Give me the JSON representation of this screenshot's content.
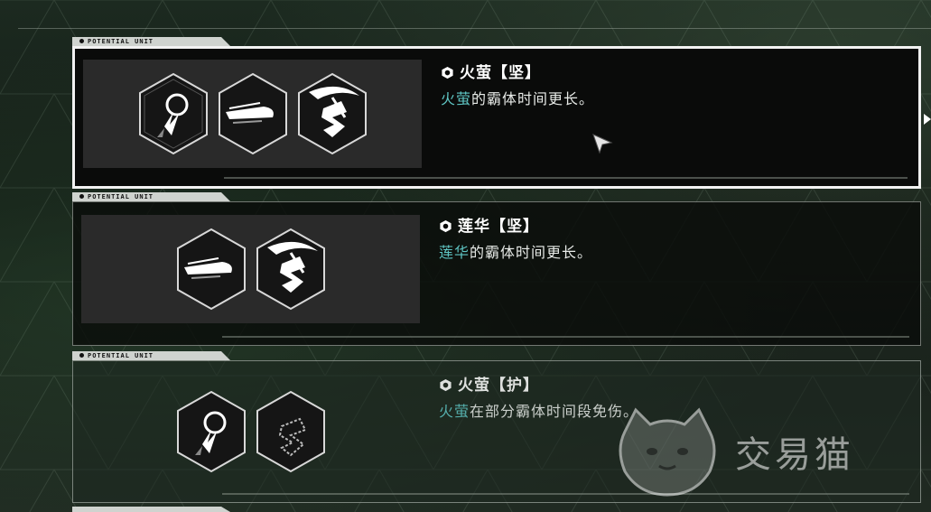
{
  "cards": [
    {
      "tag": "POTENTIAL UNIT",
      "title": "火萤【坚】",
      "desc_keyword": "火萤",
      "desc_rest": "的霸体时间更长。",
      "icons": [
        "flame-orb-icon",
        "dash-slash-icon",
        "scythe-strike-icon"
      ],
      "selected": true
    },
    {
      "tag": "POTENTIAL UNIT",
      "title": "莲华【坚】",
      "desc_keyword": "莲华",
      "desc_rest": "的霸体时间更长。",
      "icons": [
        "dash-slash-icon",
        "scythe-strike-icon"
      ],
      "selected": false
    },
    {
      "tag": "POTENTIAL UNIT",
      "title": "火萤【护】",
      "desc_keyword": "火萤",
      "desc_rest": "在部分霸体时间段免伤。",
      "icons": [
        "flame-orb-icon",
        "scythe-strike-outline-icon"
      ],
      "selected": false
    }
  ],
  "watermark": {
    "text": "交易猫"
  },
  "colors": {
    "keyword": "#5fc6c4",
    "selected_border": "#f2f2f2",
    "tag_bg": "#cfd3cf"
  }
}
